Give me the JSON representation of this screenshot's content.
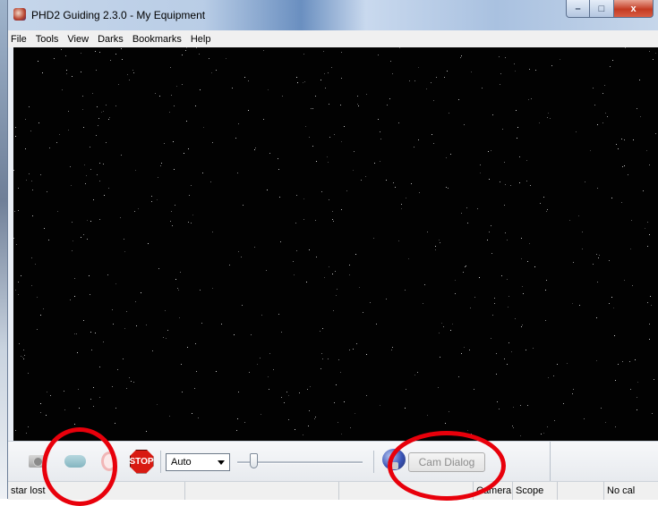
{
  "window": {
    "title": "PHD2 Guiding 2.3.0 - My Equipment",
    "controls": {
      "minimize": "–",
      "maximize": "□",
      "close": "x"
    }
  },
  "menu": [
    "File",
    "Tools",
    "View",
    "Darks",
    "Bookmarks",
    "Help"
  ],
  "toolbar": {
    "icons": [
      "camera-icon",
      "loop-icon",
      "guide-icon",
      "stop-icon",
      "brain-icon"
    ],
    "stop_label": "STOP",
    "exposure_select": {
      "value": "Auto"
    },
    "slider": {
      "value": 0.15
    },
    "cam_dialog_label": "Cam Dialog"
  },
  "status": {
    "message": "star lost",
    "camera": "Camera",
    "scope": "Scope",
    "calibration": "No cal"
  },
  "colors": {
    "annotation": "#e8000b",
    "viewer_bg": "#020202"
  }
}
